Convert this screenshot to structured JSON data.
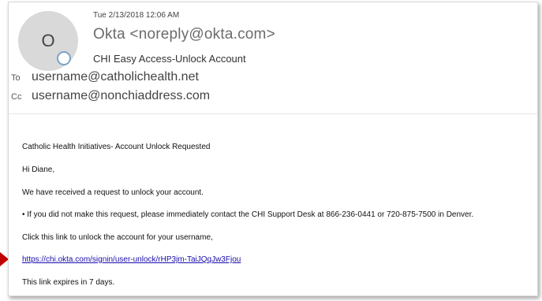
{
  "email": {
    "date": "Tue 2/13/2018 12:06 AM",
    "sender": "Okta <noreply@okta.com>",
    "avatar_initial": "O",
    "subject": "CHI Easy Access-Unlock Account",
    "to_label": "To",
    "to_value": "username@catholichealth.net",
    "cc_label": "Cc",
    "cc_value": "username@nonchiaddress.com"
  },
  "body": {
    "line1": "Catholic Health Initiatives- Account Unlock Requested",
    "greeting": "Hi Diane,",
    "line2": "We have received a request to unlock your account.",
    "line3": "• If you did not make this request, please immediately contact the CHI Support Desk at 866-236-0441 or 720-875-7500 in Denver.",
    "line4": "Click this link to unlock the account for your username,",
    "link": "https://chi.okta.com/signin/user-unlock/rHP3jm-TaiJQqJw3Fjou",
    "line5": "This link expires in 7 days."
  },
  "colors": {
    "link": "#1a0dab",
    "arrow": "#c00000",
    "presence_ring": "#7ba3c9"
  }
}
